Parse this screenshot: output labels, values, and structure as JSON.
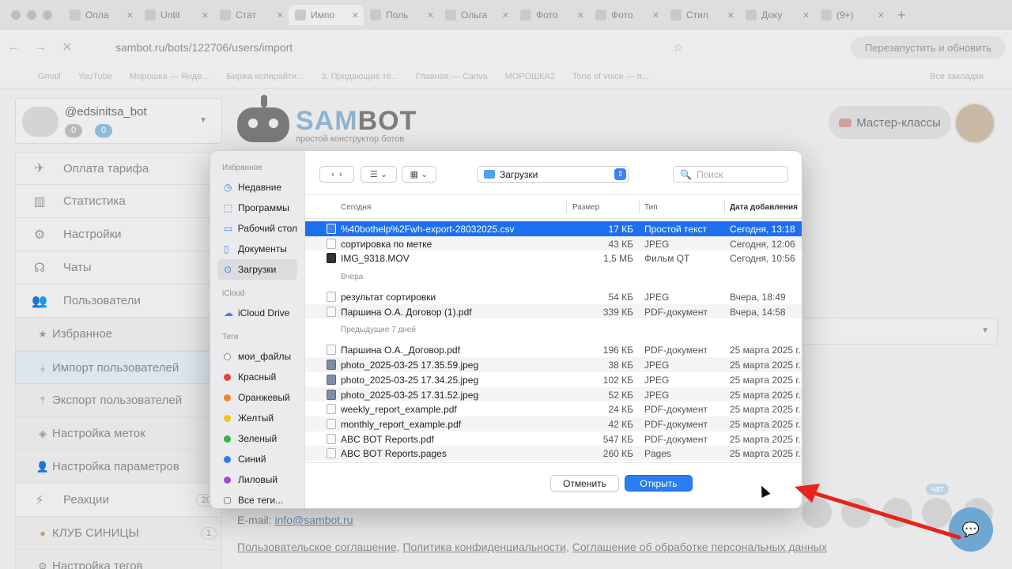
{
  "browser": {
    "tabs": [
      {
        "label": "Опла"
      },
      {
        "label": "Untit"
      },
      {
        "label": "Стат"
      },
      {
        "label": "Импо"
      },
      {
        "label": "Поль"
      },
      {
        "label": "Ольга"
      },
      {
        "label": "Фото"
      },
      {
        "label": "Фото"
      },
      {
        "label": "Стил"
      },
      {
        "label": "Доку"
      },
      {
        "label": "(9+)"
      }
    ],
    "url": "sambot.ru/bots/122706/users/import",
    "reload_button": "Перезапустить и обновить",
    "bookmarks": [
      "Gmail",
      "YouTube",
      "Морошка — Янде...",
      "Биржа копирайти...",
      "3. Продающие те...",
      "Главная — Canva",
      "МОРОШКА2",
      "Tone of voice — п..."
    ],
    "all_bookmarks": "Все закладки"
  },
  "bot": {
    "name": "@edsinitsa_bot",
    "badge1": "0",
    "badge2": "0"
  },
  "logo": {
    "part1": "SAM",
    "part2": "BOT",
    "slogan": "простой конструктор ботов"
  },
  "header": {
    "master_classes": "Мастер-классы"
  },
  "menu": [
    {
      "label": "Оплата тарифа",
      "icon": "✈"
    },
    {
      "label": "Статистика",
      "icon": "▥"
    },
    {
      "label": "Настройки",
      "icon": "⚙"
    },
    {
      "label": "Чаты",
      "icon": "☊"
    },
    {
      "label": "Пользователи",
      "icon": "👥"
    }
  ],
  "submenu": [
    {
      "label": "Избранное",
      "icon": "★"
    },
    {
      "label": "Импорт пользователей",
      "icon": "⤓"
    },
    {
      "label": "Экспорт пользователей",
      "icon": "⤒"
    },
    {
      "label": "Настройка меток",
      "icon": "◈"
    },
    {
      "label": "Настройка параметров",
      "icon": "👤"
    }
  ],
  "menu2": [
    {
      "label": "Реакции",
      "icon": "⚡",
      "count": "20"
    },
    {
      "label": "КЛУБ СИНИЦЫ",
      "count": "1"
    },
    {
      "label": "Настройка тегов"
    }
  ],
  "footer": {
    "email_label": "E-mail: ",
    "email": "info@sambot.ru",
    "links": [
      "Пользовательское соглашение",
      "Политика конфиденциальности",
      "Соглашение об обработке персональных данных"
    ],
    "chat_tag": "чат"
  },
  "dialog": {
    "sidebar": {
      "favorites_header": "Избранное",
      "favorites": [
        "Недавние",
        "Программы",
        "Рабочий стол",
        "Документы",
        "Загрузки"
      ],
      "icloud_header": "iCloud",
      "icloud": [
        "iCloud Drive"
      ],
      "tags_header": "Теги",
      "tags": [
        {
          "label": "мои_файлы",
          "color": "#ffffff"
        },
        {
          "label": "Красный",
          "color": "#e8403b"
        },
        {
          "label": "Оранжевый",
          "color": "#f08a24"
        },
        {
          "label": "Желтый",
          "color": "#f2c418"
        },
        {
          "label": "Зеленый",
          "color": "#30b548"
        },
        {
          "label": "Синий",
          "color": "#2e7df0"
        },
        {
          "label": "Лиловый",
          "color": "#a447d6"
        },
        {
          "label": "Все теги..."
        }
      ]
    },
    "toolbar": {
      "folder": "Загрузки",
      "search_placeholder": "Поиск"
    },
    "columns": {
      "name": "Сегодня",
      "size": "Размер",
      "type": "Тип",
      "date": "Дата добавления"
    },
    "groups": [
      {
        "label": "",
        "files": [
          {
            "name": "%40bothelp%2Fwh-export-28032025.csv",
            "size": "17 КБ",
            "type": "Простой текст",
            "date": "Сегодня, 13:18",
            "selected": true
          },
          {
            "name": "сортировка по метке",
            "size": "43 КБ",
            "type": "JPEG",
            "date": "Сегодня, 12:06"
          },
          {
            "name": "IMG_9318.MOV",
            "size": "1,5 МБ",
            "type": "Фильм QT",
            "date": "Сегодня, 10:56"
          }
        ]
      },
      {
        "label": "Вчера",
        "files": [
          {
            "name": "результат сортировки",
            "size": "54 КБ",
            "type": "JPEG",
            "date": "Вчера, 18:49"
          },
          {
            "name": "Паршина О.А. Договор (1).pdf",
            "size": "339 КБ",
            "type": "PDF-документ",
            "date": "Вчера, 14:58"
          }
        ]
      },
      {
        "label": "Предыдущие 7 дней",
        "files": [
          {
            "name": "Паршина О.А._Договор.pdf",
            "size": "196 КБ",
            "type": "PDF-документ",
            "date": "25 марта 2025 г."
          },
          {
            "name": "photo_2025-03-25 17.35.59.jpeg",
            "size": "38 КБ",
            "type": "JPEG",
            "date": "25 марта 2025 г."
          },
          {
            "name": "photo_2025-03-25 17.34.25.jpeg",
            "size": "102 КБ",
            "type": "JPEG",
            "date": "25 марта 2025 г."
          },
          {
            "name": "photo_2025-03-25 17.31.52.jpeg",
            "size": "52 КБ",
            "type": "JPEG",
            "date": "25 марта 2025 г."
          },
          {
            "name": "weekly_report_example.pdf",
            "size": "24 КБ",
            "type": "PDF-документ",
            "date": "25 марта 2025 г."
          },
          {
            "name": "monthly_report_example.pdf",
            "size": "42 КБ",
            "type": "PDF-документ",
            "date": "25 марта 2025 г."
          },
          {
            "name": "ABC BOT Reports.pdf",
            "size": "547 КБ",
            "type": "PDF-документ",
            "date": "25 марта 2025 г."
          },
          {
            "name": "ABC BOT Reports.pages",
            "size": "260 КБ",
            "type": "Pages",
            "date": "25 марта 2025 г."
          }
        ]
      }
    ],
    "cancel": "Отменить",
    "open": "Открыть"
  }
}
